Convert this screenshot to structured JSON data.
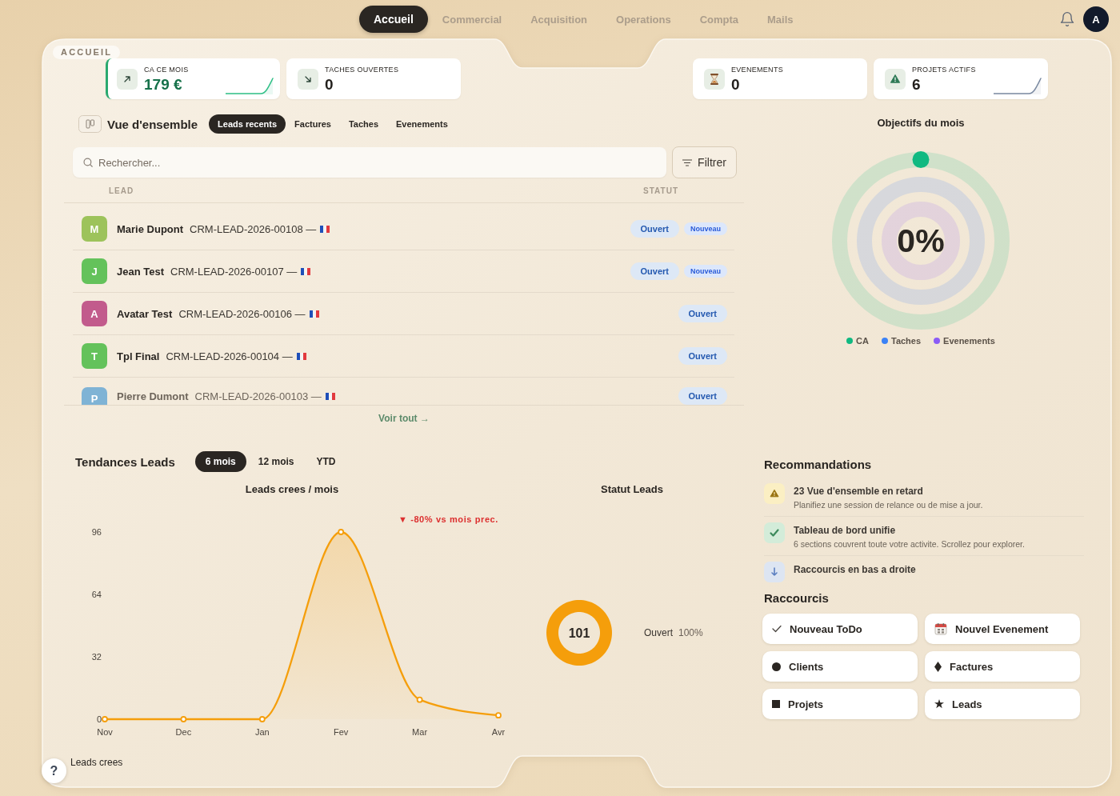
{
  "nav": {
    "tabs": [
      {
        "label": "Accueil",
        "selected": true
      },
      {
        "label": "Commercial",
        "selected": false
      },
      {
        "label": "Acquisition",
        "selected": false
      },
      {
        "label": "Operations",
        "selected": false
      },
      {
        "label": "Compta",
        "selected": false
      },
      {
        "label": "Mails",
        "selected": false
      }
    ],
    "avatar": "A"
  },
  "breadcrumb": "ACCUEIL",
  "kpis": [
    {
      "label": "CA CE MOIS",
      "value": "179 €",
      "kind": "trend-up",
      "accent": true,
      "sparkline": true
    },
    {
      "label": "TACHES OUVERTES",
      "value": "0",
      "kind": "trend-down",
      "accent": false,
      "sparkline": false
    },
    {
      "label": "EVENEMENTS",
      "value": "0",
      "kind": "hourglass",
      "accent": false,
      "sparkline": false
    },
    {
      "label": "PROJETS ACTIFS",
      "value": "6",
      "kind": "alert",
      "accent": false,
      "sparkline": true
    }
  ],
  "overview": {
    "title": "Vue d'ensemble",
    "tabs": [
      {
        "label": "Leads recents",
        "selected": true
      },
      {
        "label": "Factures",
        "selected": false
      },
      {
        "label": "Taches",
        "selected": false
      },
      {
        "label": "Evenements",
        "selected": false
      }
    ],
    "search": {
      "placeholder": "Rechercher..."
    },
    "filter_button": "Filtrer",
    "columns": [
      "LEAD",
      "STATUT"
    ],
    "rows": [
      {
        "initial": "M",
        "name": "Marie Dupont",
        "code": "CRM-LEAD-2026-00108 —",
        "color": "#9dc35b",
        "status": "Ouvert",
        "tag": "Nouveau"
      },
      {
        "initial": "J",
        "name": "Jean Test",
        "code": "CRM-LEAD-2026-00107 —",
        "color": "#64c25b",
        "status": "Ouvert",
        "tag": "Nouveau"
      },
      {
        "initial": "A",
        "name": "Avatar Test",
        "code": "CRM-LEAD-2026-00106 —",
        "color": "#c25b8c",
        "status": "Ouvert"
      },
      {
        "initial": "T",
        "name": "Tpl Final",
        "code": "CRM-LEAD-2026-00104 —",
        "color": "#64c25b",
        "status": "Ouvert"
      },
      {
        "initial": "P",
        "name": "Pierre Dumont",
        "code": "CRM-LEAD-2026-00103 —",
        "color": "#7fb3d5",
        "status": "Ouvert"
      }
    ],
    "view_all": "Voir tout →"
  },
  "objectives": {
    "title": "Objectifs du mois",
    "center_label": "0%",
    "rings": [
      {
        "label": "CA",
        "color": "#10b981",
        "marker": true
      },
      {
        "label": "Taches",
        "color": "#3b82f6",
        "marker": false
      },
      {
        "label": "Evenements",
        "color": "#8b5cf6",
        "marker": false
      }
    ]
  },
  "trends": {
    "title": "Tendances Leads",
    "periods": [
      {
        "label": "6 mois",
        "selected": true
      },
      {
        "label": "12 mois",
        "selected": false
      },
      {
        "label": "YTD",
        "selected": false
      }
    ],
    "line_chart": {
      "chart_data": {
        "type": "area",
        "title": "Leads crees / mois",
        "categories": [
          "Nov",
          "Dec",
          "Jan",
          "Fev",
          "Mar",
          "Avr"
        ],
        "series": [
          {
            "name": "Leads crees",
            "color": "#f59e0b",
            "values": [
              0,
              0,
              0,
              96,
              10,
              2
            ]
          }
        ],
        "ylim": [
          0,
          96
        ],
        "yticks": [
          0,
          32,
          64,
          96
        ],
        "annotations": [
          "▼ -80% vs mois prec."
        ]
      }
    },
    "status_chart": {
      "title": "Statut Leads",
      "total": "101",
      "chart_data": {
        "type": "donut",
        "categories": [
          "Ouvert"
        ],
        "series": [
          {
            "color": "#f59e0b",
            "values": [
              101
            ]
          }
        ],
        "value_labels": [
          "100%"
        ]
      }
    }
  },
  "recommendations": {
    "title": "Recommandations",
    "items": [
      {
        "kind": "warning",
        "title": "23 Vue d'ensemble en retard",
        "description": "Planifiez une session de relance ou de mise a jour."
      },
      {
        "kind": "success",
        "title": "Tableau de bord unifie",
        "description": "6 sections couvrent toute votre activite. Scrollez pour explorer."
      },
      {
        "kind": "info",
        "title": "Raccourcis en bas a droite"
      }
    ]
  },
  "shortcuts": {
    "title": "Raccourcis",
    "items": [
      {
        "kind": "check",
        "label": "Nouveau ToDo"
      },
      {
        "kind": "calendar",
        "label": "Nouvel Evenement"
      },
      {
        "kind": "dot",
        "label": "Clients"
      },
      {
        "kind": "diamond",
        "label": "Factures"
      },
      {
        "kind": "square",
        "label": "Projets"
      },
      {
        "kind": "star",
        "label": "Leads"
      }
    ]
  },
  "help_button": "?"
}
